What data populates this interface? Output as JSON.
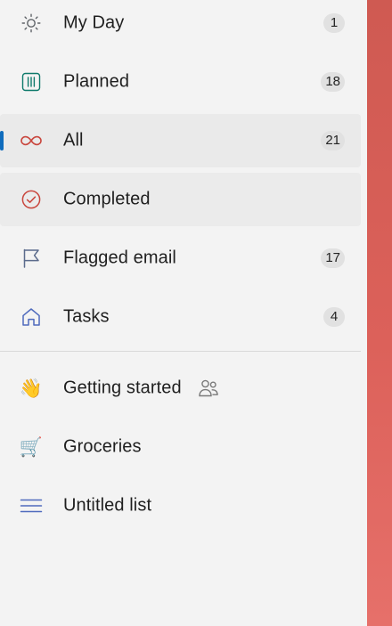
{
  "nav": {
    "smart_lists": [
      {
        "label": "My Day",
        "icon": "sun-icon",
        "count": "1",
        "icon_color": "#5f6368"
      },
      {
        "label": "Planned",
        "icon": "calendar-grid-icon",
        "count": "18",
        "icon_color": "#0e7a6b"
      },
      {
        "label": "All",
        "icon": "infinity-icon",
        "count": "21",
        "icon_color": "#c9463d",
        "selected": true
      },
      {
        "label": "Completed",
        "icon": "check-circle-icon",
        "count": "",
        "icon_color": "#c9463d"
      },
      {
        "label": "Flagged email",
        "icon": "flag-icon",
        "count": "17",
        "icon_color": "#5b6b8c"
      },
      {
        "label": "Tasks",
        "icon": "home-icon",
        "count": "4",
        "icon_color": "#4f6bbd"
      }
    ],
    "custom_lists": [
      {
        "label": "Getting started",
        "icon": "waving-hand-icon",
        "emoji": "👋",
        "shared": true
      },
      {
        "label": "Groceries",
        "icon": "shopping-cart-icon",
        "emoji": "🛒"
      },
      {
        "label": "Untitled list",
        "icon": "list-lines-icon",
        "icon_color": "#4f6bbd"
      }
    ]
  },
  "colors": {
    "selection_indicator": "#0f6cbd",
    "accent_strip": "#dc615a",
    "sidebar_bg": "#f3f3f3"
  }
}
